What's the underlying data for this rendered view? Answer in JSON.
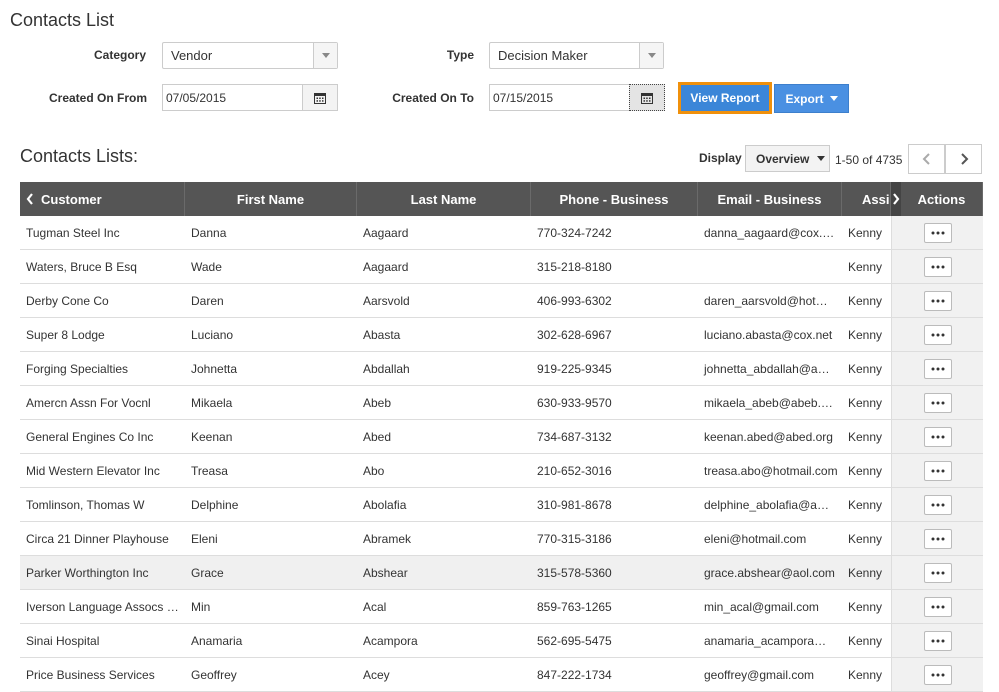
{
  "page": {
    "title": "Contacts List"
  },
  "filters": {
    "category_label": "Category",
    "category_value": "Vendor",
    "type_label": "Type",
    "type_value": "Decision Maker",
    "created_from_label": "Created On From",
    "created_from_value": "07/05/2015",
    "created_to_label": "Created On To",
    "created_to_value": "07/15/2015"
  },
  "buttons": {
    "view_report": "View Report",
    "export": "Export"
  },
  "list": {
    "title": "Contacts Lists:",
    "display_label": "Display",
    "display_value": "Overview",
    "range_text": "1-50 of 4735"
  },
  "columns": [
    "Customer",
    "First Name",
    "Last Name",
    "Phone - Business",
    "Email - Business",
    "Assi",
    "Actions"
  ],
  "rows": [
    {
      "customer": "Tugman Steel Inc",
      "first": "Danna",
      "last": "Aagaard",
      "phone": "770-324-7242",
      "email": "danna_aagaard@cox.…",
      "assigned": "Kenny"
    },
    {
      "customer": "Waters, Bruce B Esq",
      "first": "Wade",
      "last": "Aagaard",
      "phone": "315-218-8180",
      "email": "",
      "assigned": "Kenny"
    },
    {
      "customer": "Derby Cone Co",
      "first": "Daren",
      "last": "Aarsvold",
      "phone": "406-993-6302",
      "email": "daren_aarsvold@hot…",
      "assigned": "Kenny"
    },
    {
      "customer": "Super 8 Lodge",
      "first": "Luciano",
      "last": "Abasta",
      "phone": "302-628-6967",
      "email": "luciano.abasta@cox.net",
      "assigned": "Kenny"
    },
    {
      "customer": "Forging Specialties",
      "first": "Johnetta",
      "last": "Abdallah",
      "phone": "919-225-9345",
      "email": "johnetta_abdallah@a…",
      "assigned": "Kenny"
    },
    {
      "customer": "Amercn Assn For Vocnl",
      "first": "Mikaela",
      "last": "Abeb",
      "phone": "630-933-9570",
      "email": "mikaela_abeb@abeb.…",
      "assigned": "Kenny"
    },
    {
      "customer": "General Engines Co Inc",
      "first": "Keenan",
      "last": "Abed",
      "phone": "734-687-3132",
      "email": "keenan.abed@abed.org",
      "assigned": "Kenny"
    },
    {
      "customer": "Mid Western Elevator Inc",
      "first": "Treasa",
      "last": "Abo",
      "phone": "210-652-3016",
      "email": "treasa.abo@hotmail.com",
      "assigned": "Kenny"
    },
    {
      "customer": "Tomlinson, Thomas W",
      "first": "Delphine",
      "last": "Abolafia",
      "phone": "310-981-8678",
      "email": "delphine_abolafia@a…",
      "assigned": "Kenny"
    },
    {
      "customer": "Circa 21 Dinner Playhouse",
      "first": "Eleni",
      "last": "Abramek",
      "phone": "770-315-3186",
      "email": "eleni@hotmail.com",
      "assigned": "Kenny"
    },
    {
      "customer": "Parker Worthington Inc",
      "first": "Grace",
      "last": "Abshear",
      "phone": "315-578-5360",
      "email": "grace.abshear@aol.com",
      "assigned": "Kenny"
    },
    {
      "customer": "Iverson Language Assocs …",
      "first": "Min",
      "last": "Acal",
      "phone": "859-763-1265",
      "email": "min_acal@gmail.com",
      "assigned": "Kenny"
    },
    {
      "customer": "Sinai Hospital",
      "first": "Anamaria",
      "last": "Acampora",
      "phone": "562-695-5475",
      "email": "anamaria_acampora…",
      "assigned": "Kenny"
    },
    {
      "customer": "Price Business Services",
      "first": "Geoffrey",
      "last": "Acey",
      "phone": "847-222-1734",
      "email": "geoffrey@gmail.com",
      "assigned": "Kenny"
    }
  ],
  "icons": {
    "calendar": "calendar-icon",
    "ellipsis": "ellipsis-icon"
  },
  "colors": {
    "header_bg": "#555555",
    "view_report_bg": "#3b86d8",
    "view_report_border": "#f0900b",
    "export_bg": "#4a90e2"
  }
}
